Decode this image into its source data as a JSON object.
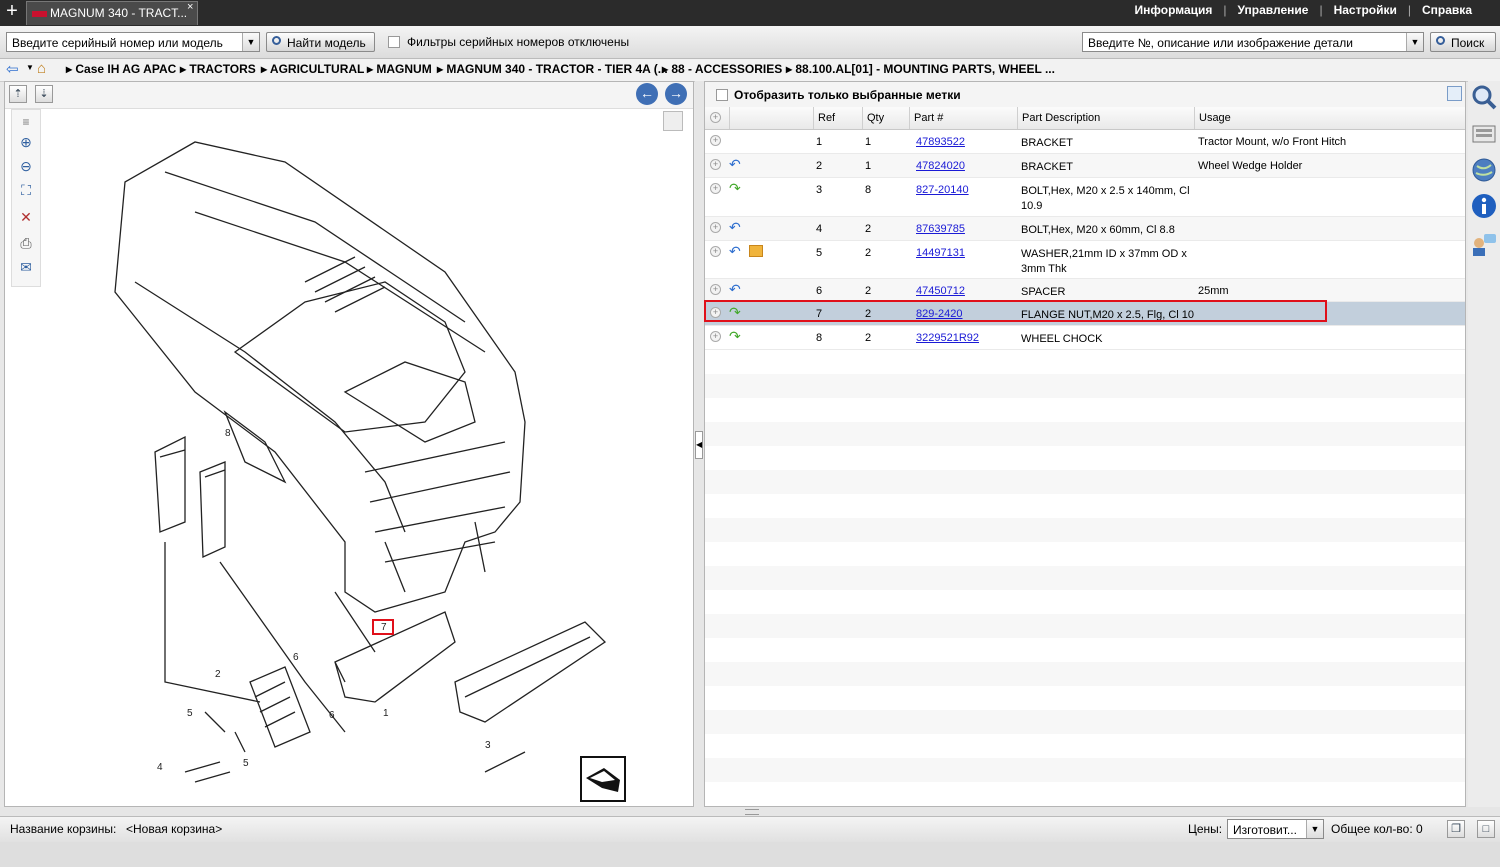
{
  "tab": {
    "title": "MAGNUM 340 - TRACT...",
    "close": "×",
    "add": "+"
  },
  "top_menu": [
    "Информация",
    "Управление",
    "Настройки",
    "Справка"
  ],
  "toolbar": {
    "serial_input": "Введите серийный номер или модель",
    "find_model": "Найти модель",
    "serial_filters": "Фильтры серийных номеров отключены",
    "part_search": "Введите №, описание или изображение детали",
    "search": "Поиск"
  },
  "breadcrumb": [
    "Case IH AG APAC",
    "TRACTORS",
    "AGRICULTURAL",
    "MAGNUM",
    "MAGNUM 340 - TRACTOR - TIER 4A (...",
    "88 - ACCESSORIES",
    "88.100.AL[01] - MOUNTING PARTS, WHEEL ..."
  ],
  "right_panel": {
    "show_selected_only": "Отобразить только выбранные метки"
  },
  "columns": {
    "ref": "Ref",
    "qty": "Qty",
    "part": "Part #",
    "desc": "Part Description",
    "usage": "Usage"
  },
  "parts": [
    {
      "ref": "1",
      "qty": "1",
      "part": "47893522",
      "desc": "BRACKET",
      "usage": "Tractor Mount, w/o Front Hitch",
      "indicator": "none"
    },
    {
      "ref": "2",
      "qty": "1",
      "part": "47824020",
      "desc": "BRACKET",
      "usage": "Wheel Wedge Holder",
      "indicator": "blue"
    },
    {
      "ref": "3",
      "qty": "8",
      "part": "827-20140",
      "desc": "BOLT,Hex, M20 x 2.5 x 140mm, Cl 10.9",
      "usage": "",
      "indicator": "green"
    },
    {
      "ref": "4",
      "qty": "2",
      "part": "87639785",
      "desc": "BOLT,Hex, M20 x 60mm, Cl 8.8",
      "usage": "",
      "indicator": "blue"
    },
    {
      "ref": "5",
      "qty": "2",
      "part": "14497131",
      "desc": "WASHER,21mm ID x 37mm OD x 3mm Thk",
      "usage": "",
      "indicator": "blue-package"
    },
    {
      "ref": "6",
      "qty": "2",
      "part": "47450712",
      "desc": "SPACER",
      "usage": "25mm",
      "indicator": "blue"
    },
    {
      "ref": "7",
      "qty": "2",
      "part": "829-2420",
      "desc": "FLANGE NUT,M20 x 2.5, Flg, Cl 10",
      "usage": "",
      "indicator": "green"
    },
    {
      "ref": "8",
      "qty": "2",
      "part": "3229521R92",
      "desc": "WHEEL CHOCK",
      "usage": "",
      "indicator": "green"
    }
  ],
  "diagram_callouts": [
    "8",
    "7",
    "6",
    "2",
    "5",
    "6",
    "1",
    "4",
    "5",
    "3"
  ],
  "status": {
    "cart_label": "Название корзины:",
    "cart_name": "<Новая корзина>",
    "prices_label": "Цены:",
    "prices_value": "Изготовит...",
    "total_label": "Общее кол-во: 0"
  }
}
